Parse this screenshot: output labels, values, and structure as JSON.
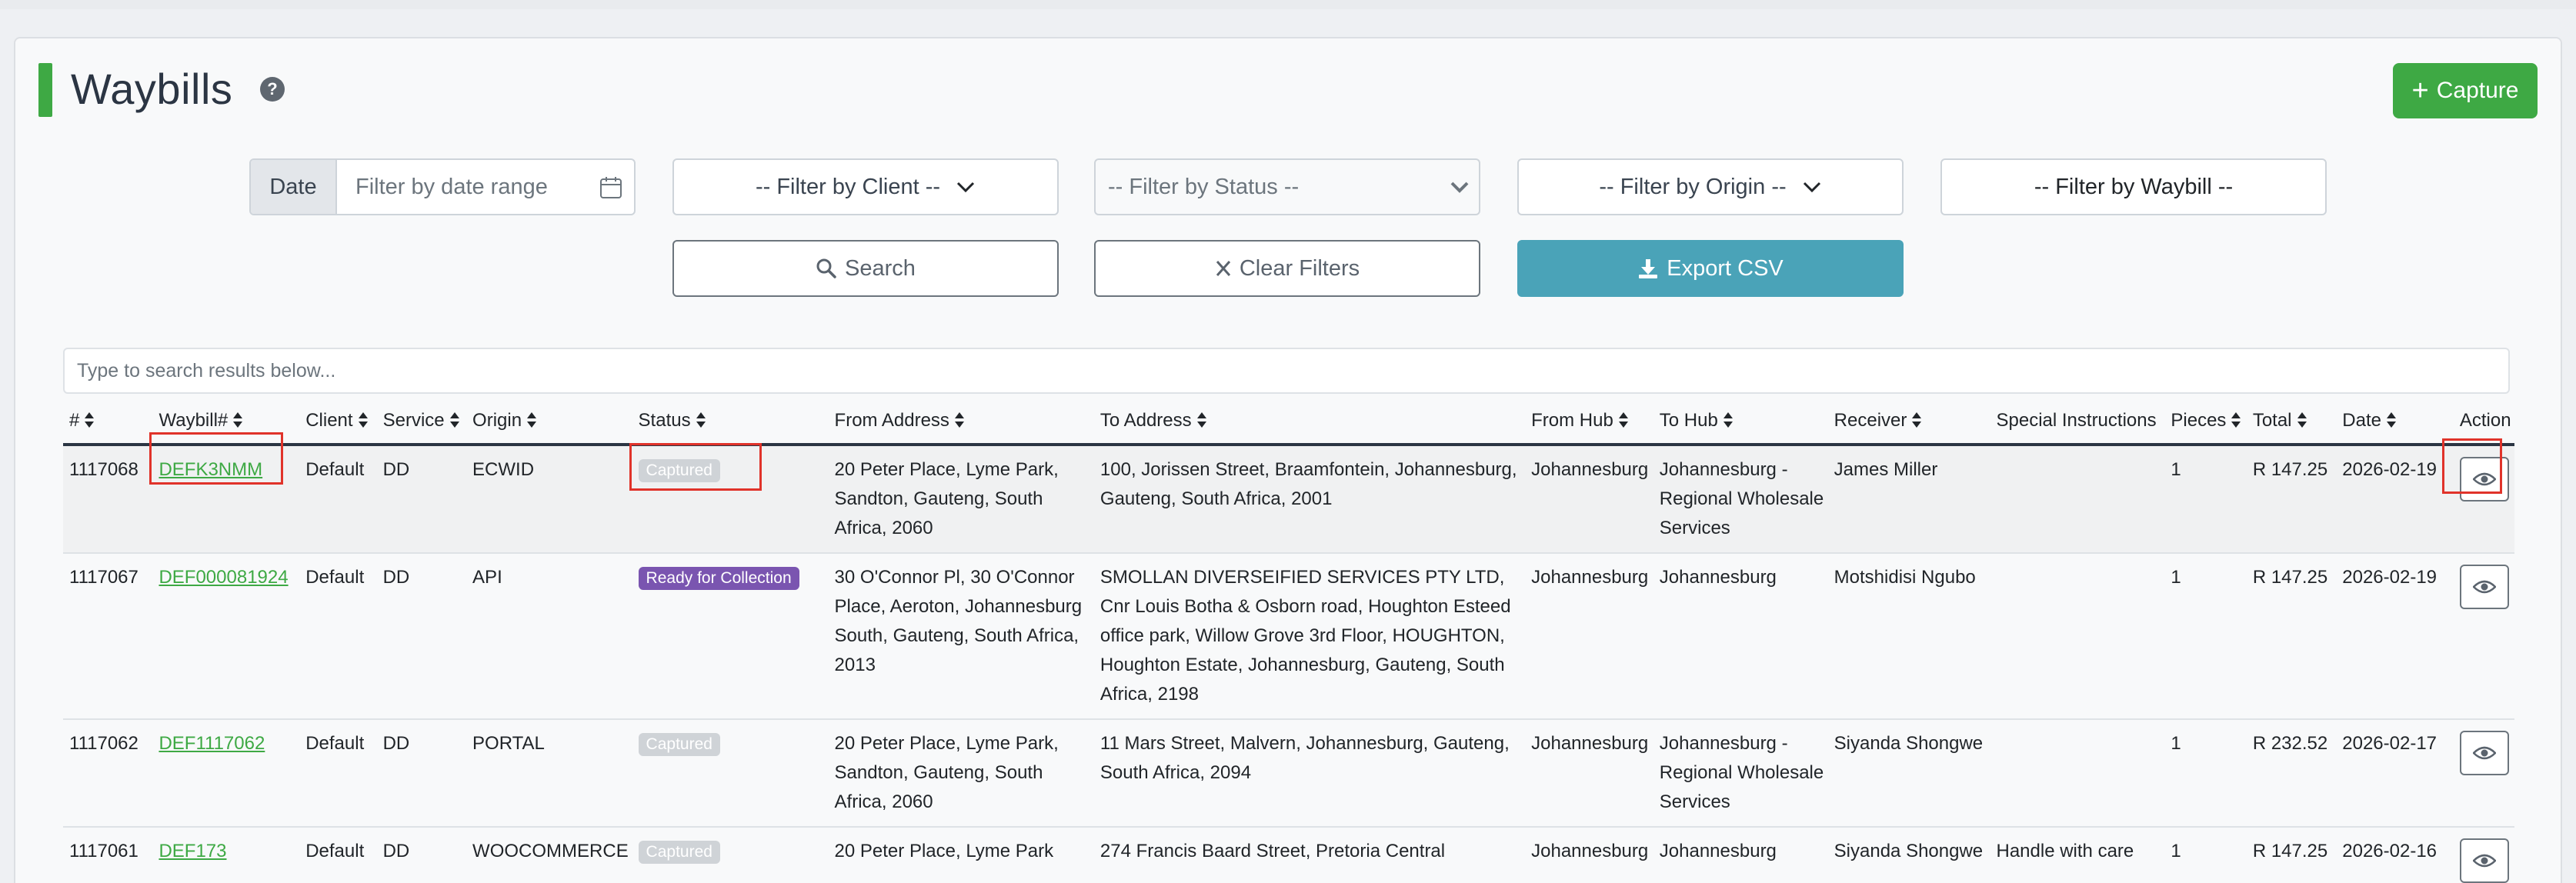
{
  "page": {
    "title": "Waybills",
    "help_icon": "?",
    "capture_label": "Capture",
    "capture_icon": "+"
  },
  "filters": {
    "date_label": "Date",
    "date_placeholder": "Filter by date range",
    "client": "-- Filter by Client --",
    "status": "-- Filter by Status --",
    "origin": "-- Filter by Origin --",
    "waybill": "-- Filter by Waybill --"
  },
  "actions": {
    "search": "Search",
    "clear": "Clear Filters",
    "export": "Export CSV"
  },
  "results_search_placeholder": "Type to search results below...",
  "table": {
    "headers": {
      "id": "#",
      "waybill": "Waybill#",
      "client": "Client",
      "service": "Service",
      "origin": "Origin",
      "status": "Status",
      "from_address": "From Address",
      "to_address": "To Address",
      "from_hub": "From Hub",
      "to_hub": "To Hub",
      "receiver": "Receiver",
      "special": "Special Instructions",
      "pieces": "Pieces",
      "total": "Total",
      "date": "Date",
      "action": "Action"
    },
    "rows": [
      {
        "id": "1117068",
        "waybill": "DEFK3NMM",
        "client": "Default",
        "service": "DD",
        "origin": "ECWID",
        "status": "Captured",
        "from_address": "20 Peter Place, Lyme Park, Sandton, Gauteng, South Africa, 2060",
        "to_address": "100, Jorissen Street, Braamfontein, Johannesburg, Gauteng, South Africa, 2001",
        "from_hub": "Johannesburg",
        "to_hub": "Johannesburg - Regional Wholesale Services",
        "receiver": "James Miller",
        "special": "",
        "pieces": "1",
        "total": "R 147.25",
        "date": "2026-02-19"
      },
      {
        "id": "1117067",
        "waybill": "DEF000081924",
        "client": "Default",
        "service": "DD",
        "origin": "API",
        "status": "Ready for Collection",
        "from_address": "30 O'Connor Pl, 30 O'Connor Place, Aeroton, Johannesburg South, Gauteng, South Africa, 2013",
        "to_address": "SMOLLAN DIVERSEIFIED SERVICES PTY LTD, Cnr Louis Botha & Osborn road, Houghton Esteed office park, Willow Grove 3rd Floor, HOUGHTON, Houghton Estate, Johannesburg, Gauteng, South Africa, 2198",
        "from_hub": "Johannesburg",
        "to_hub": "Johannesburg",
        "receiver": "Motshidisi Ngubo",
        "special": "",
        "pieces": "1",
        "total": "R 147.25",
        "date": "2026-02-19"
      },
      {
        "id": "1117062",
        "waybill": "DEF1117062",
        "client": "Default",
        "service": "DD",
        "origin": "PORTAL",
        "status": "Captured",
        "from_address": "20 Peter Place, Lyme Park, Sandton, Gauteng, South Africa, 2060",
        "to_address": "11 Mars Street, Malvern, Johannesburg, Gauteng, South Africa, 2094",
        "from_hub": "Johannesburg",
        "to_hub": "Johannesburg - Regional Wholesale Services",
        "receiver": "Siyanda Shongwe",
        "special": "",
        "pieces": "1",
        "total": "R 232.52",
        "date": "2026-02-17"
      },
      {
        "id": "1117061",
        "waybill": "DEF173",
        "client": "Default",
        "service": "DD",
        "origin": "WOOCOMMERCE",
        "status": "Captured",
        "from_address": "20 Peter Place, Lyme Park",
        "to_address": "274 Francis Baard Street, Pretoria Central",
        "from_hub": "Johannesburg",
        "to_hub": "Johannesburg",
        "receiver": "Siyanda Shongwe",
        "special": "Handle with care",
        "pieces": "1",
        "total": "R 147.25",
        "date": "2026-02-16"
      }
    ]
  }
}
